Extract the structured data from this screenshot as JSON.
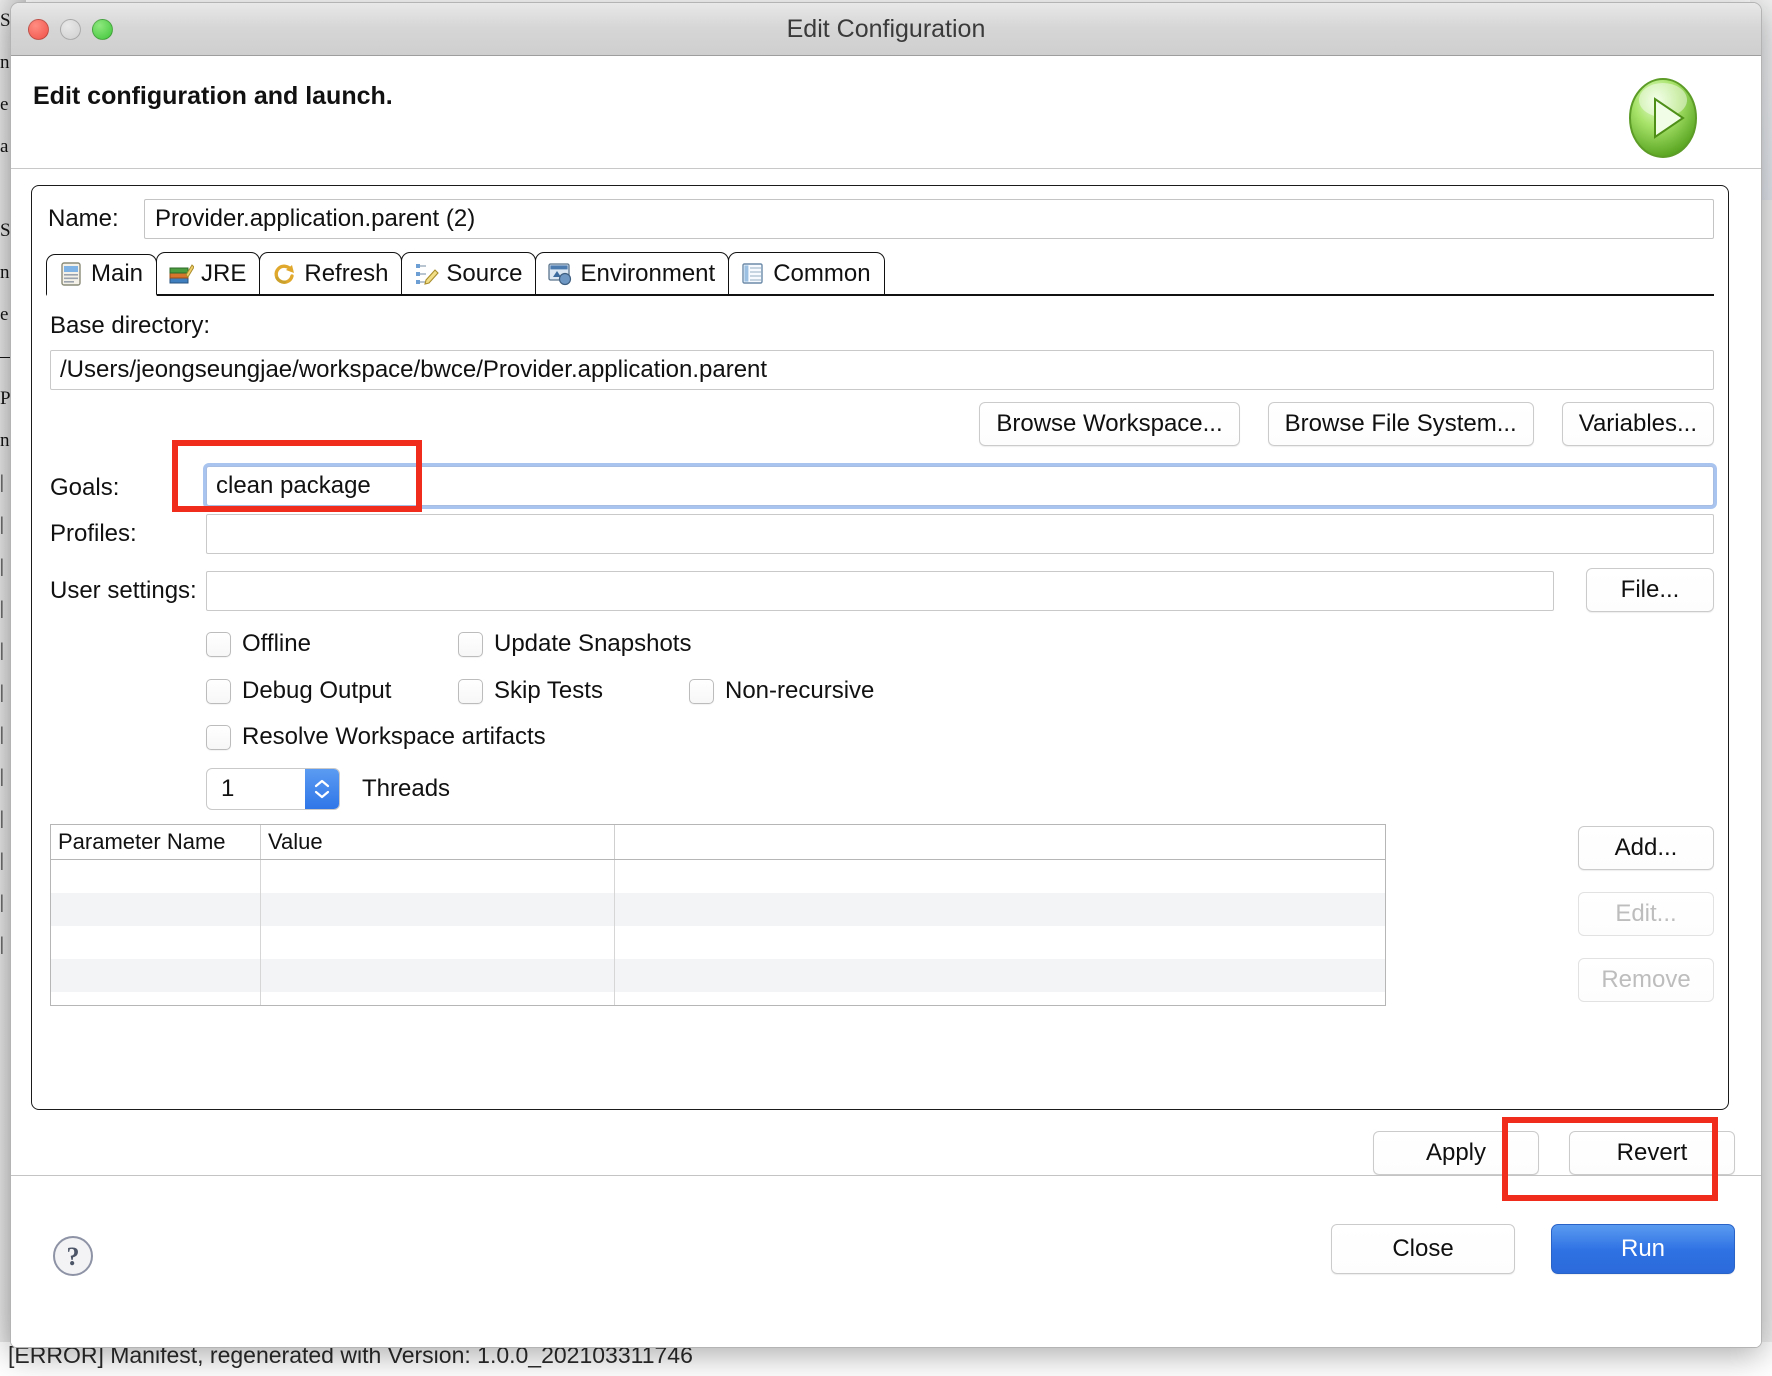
{
  "window": {
    "title": "Edit Configuration",
    "traffic_lights": [
      "close-red",
      "minimize-yellow",
      "zoom-green"
    ]
  },
  "header": {
    "title": "Edit configuration and launch.",
    "badge_icon": "run-green-play-icon"
  },
  "name_field": {
    "label": "Name:",
    "value": "Provider.application.parent (2)"
  },
  "tabs": [
    {
      "label": "Main",
      "icon": "main-clipboard-icon",
      "active": true
    },
    {
      "label": "JRE",
      "icon": "jre-books-icon",
      "active": false
    },
    {
      "label": "Refresh",
      "icon": "refresh-arrows-icon",
      "active": false
    },
    {
      "label": "Source",
      "icon": "source-pencil-icon",
      "active": false
    },
    {
      "label": "Environment",
      "icon": "environment-icon",
      "active": false
    },
    {
      "label": "Common",
      "icon": "common-table-icon",
      "active": false
    }
  ],
  "main_tab": {
    "base_directory": {
      "label": "Base directory:",
      "value": "/Users/jeongseungjae/workspace/bwce/Provider.application.parent"
    },
    "browse_buttons": [
      {
        "label": "Browse Workspace...",
        "name": "browse-workspace-button"
      },
      {
        "label": "Browse File System...",
        "name": "browse-file-system-button"
      },
      {
        "label": "Variables...",
        "name": "variables-button"
      }
    ],
    "goals": {
      "label": "Goals:",
      "value": "clean package",
      "focused": true,
      "highlighted": true
    },
    "profiles": {
      "label": "Profiles:",
      "value": ""
    },
    "user_settings": {
      "label": "User settings:",
      "value": "",
      "button_label": "File..."
    },
    "checkboxes": [
      {
        "label": "Offline",
        "checked": false,
        "name": "offline-checkbox"
      },
      {
        "label": "Update Snapshots",
        "checked": false,
        "name": "update-snapshots-checkbox"
      },
      {
        "label": "Debug Output",
        "checked": false,
        "name": "debug-output-checkbox"
      },
      {
        "label": "Skip Tests",
        "checked": false,
        "name": "skip-tests-checkbox"
      },
      {
        "label": "Non-recursive",
        "checked": false,
        "name": "non-recursive-checkbox"
      },
      {
        "label": "Resolve Workspace artifacts",
        "checked": false,
        "name": "resolve-workspace-artifacts-checkbox"
      }
    ],
    "threads": {
      "value": "1",
      "label": "Threads"
    },
    "parameters_table": {
      "columns": [
        "Parameter Name",
        "Value"
      ],
      "rows": [],
      "empty_row_count": 5,
      "buttons": [
        {
          "label": "Add...",
          "enabled": true,
          "name": "add-parameter-button"
        },
        {
          "label": "Edit...",
          "enabled": false,
          "name": "edit-parameter-button"
        },
        {
          "label": "Remove",
          "enabled": false,
          "name": "remove-parameter-button"
        }
      ]
    }
  },
  "apply_revert": [
    {
      "label": "Apply",
      "name": "apply-button"
    },
    {
      "label": "Revert",
      "name": "revert-button"
    }
  ],
  "footer": {
    "help_icon": "help-question-icon",
    "close_label": "Close",
    "run_label": "Run",
    "run_highlighted": true
  },
  "background": {
    "bottom_text": "[ERROR] Manifest, regenerated with Version: 1.0.0_202103311746",
    "left_strip_chars": "S\nn\ne\na\n \nS\nn\ne\n—\nP\nn\n|\n|\n|\n|\n|\n|\n|\n|\n|\n|\n|\n|"
  },
  "colors": {
    "annotation_red": "#f02d1c",
    "run_blue": "#2f72e4",
    "focus_blue": "#a9c4ef",
    "stepper_blue": "#3b81ec",
    "titlebar_gray": "#d6d6d6"
  }
}
